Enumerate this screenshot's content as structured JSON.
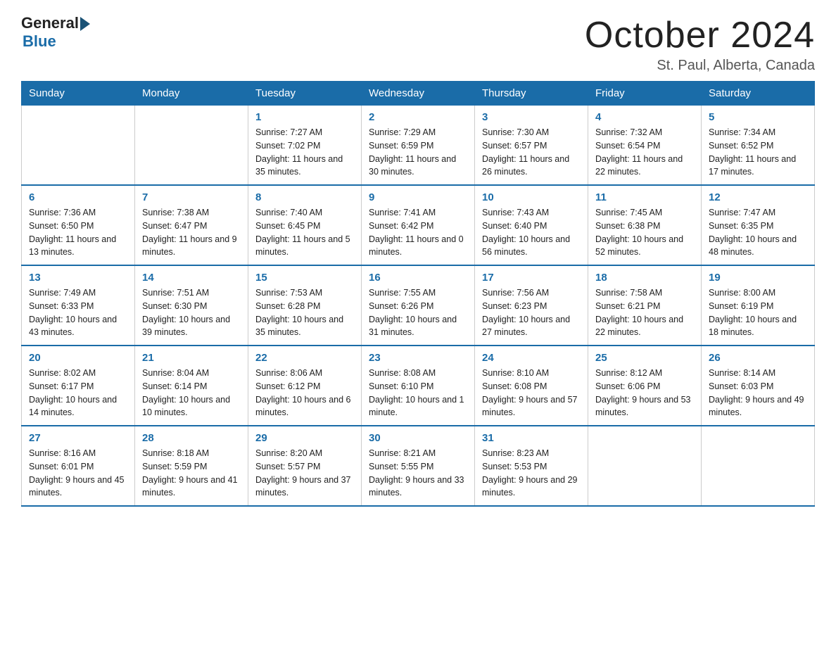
{
  "logo": {
    "general": "General",
    "blue": "Blue"
  },
  "title": "October 2024",
  "location": "St. Paul, Alberta, Canada",
  "days_of_week": [
    "Sunday",
    "Monday",
    "Tuesday",
    "Wednesday",
    "Thursday",
    "Friday",
    "Saturday"
  ],
  "weeks": [
    [
      {
        "day": "",
        "info": ""
      },
      {
        "day": "",
        "info": ""
      },
      {
        "day": "1",
        "info": "Sunrise: 7:27 AM\nSunset: 7:02 PM\nDaylight: 11 hours and 35 minutes."
      },
      {
        "day": "2",
        "info": "Sunrise: 7:29 AM\nSunset: 6:59 PM\nDaylight: 11 hours and 30 minutes."
      },
      {
        "day": "3",
        "info": "Sunrise: 7:30 AM\nSunset: 6:57 PM\nDaylight: 11 hours and 26 minutes."
      },
      {
        "day": "4",
        "info": "Sunrise: 7:32 AM\nSunset: 6:54 PM\nDaylight: 11 hours and 22 minutes."
      },
      {
        "day": "5",
        "info": "Sunrise: 7:34 AM\nSunset: 6:52 PM\nDaylight: 11 hours and 17 minutes."
      }
    ],
    [
      {
        "day": "6",
        "info": "Sunrise: 7:36 AM\nSunset: 6:50 PM\nDaylight: 11 hours and 13 minutes."
      },
      {
        "day": "7",
        "info": "Sunrise: 7:38 AM\nSunset: 6:47 PM\nDaylight: 11 hours and 9 minutes."
      },
      {
        "day": "8",
        "info": "Sunrise: 7:40 AM\nSunset: 6:45 PM\nDaylight: 11 hours and 5 minutes."
      },
      {
        "day": "9",
        "info": "Sunrise: 7:41 AM\nSunset: 6:42 PM\nDaylight: 11 hours and 0 minutes."
      },
      {
        "day": "10",
        "info": "Sunrise: 7:43 AM\nSunset: 6:40 PM\nDaylight: 10 hours and 56 minutes."
      },
      {
        "day": "11",
        "info": "Sunrise: 7:45 AM\nSunset: 6:38 PM\nDaylight: 10 hours and 52 minutes."
      },
      {
        "day": "12",
        "info": "Sunrise: 7:47 AM\nSunset: 6:35 PM\nDaylight: 10 hours and 48 minutes."
      }
    ],
    [
      {
        "day": "13",
        "info": "Sunrise: 7:49 AM\nSunset: 6:33 PM\nDaylight: 10 hours and 43 minutes."
      },
      {
        "day": "14",
        "info": "Sunrise: 7:51 AM\nSunset: 6:30 PM\nDaylight: 10 hours and 39 minutes."
      },
      {
        "day": "15",
        "info": "Sunrise: 7:53 AM\nSunset: 6:28 PM\nDaylight: 10 hours and 35 minutes."
      },
      {
        "day": "16",
        "info": "Sunrise: 7:55 AM\nSunset: 6:26 PM\nDaylight: 10 hours and 31 minutes."
      },
      {
        "day": "17",
        "info": "Sunrise: 7:56 AM\nSunset: 6:23 PM\nDaylight: 10 hours and 27 minutes."
      },
      {
        "day": "18",
        "info": "Sunrise: 7:58 AM\nSunset: 6:21 PM\nDaylight: 10 hours and 22 minutes."
      },
      {
        "day": "19",
        "info": "Sunrise: 8:00 AM\nSunset: 6:19 PM\nDaylight: 10 hours and 18 minutes."
      }
    ],
    [
      {
        "day": "20",
        "info": "Sunrise: 8:02 AM\nSunset: 6:17 PM\nDaylight: 10 hours and 14 minutes."
      },
      {
        "day": "21",
        "info": "Sunrise: 8:04 AM\nSunset: 6:14 PM\nDaylight: 10 hours and 10 minutes."
      },
      {
        "day": "22",
        "info": "Sunrise: 8:06 AM\nSunset: 6:12 PM\nDaylight: 10 hours and 6 minutes."
      },
      {
        "day": "23",
        "info": "Sunrise: 8:08 AM\nSunset: 6:10 PM\nDaylight: 10 hours and 1 minute."
      },
      {
        "day": "24",
        "info": "Sunrise: 8:10 AM\nSunset: 6:08 PM\nDaylight: 9 hours and 57 minutes."
      },
      {
        "day": "25",
        "info": "Sunrise: 8:12 AM\nSunset: 6:06 PM\nDaylight: 9 hours and 53 minutes."
      },
      {
        "day": "26",
        "info": "Sunrise: 8:14 AM\nSunset: 6:03 PM\nDaylight: 9 hours and 49 minutes."
      }
    ],
    [
      {
        "day": "27",
        "info": "Sunrise: 8:16 AM\nSunset: 6:01 PM\nDaylight: 9 hours and 45 minutes."
      },
      {
        "day": "28",
        "info": "Sunrise: 8:18 AM\nSunset: 5:59 PM\nDaylight: 9 hours and 41 minutes."
      },
      {
        "day": "29",
        "info": "Sunrise: 8:20 AM\nSunset: 5:57 PM\nDaylight: 9 hours and 37 minutes."
      },
      {
        "day": "30",
        "info": "Sunrise: 8:21 AM\nSunset: 5:55 PM\nDaylight: 9 hours and 33 minutes."
      },
      {
        "day": "31",
        "info": "Sunrise: 8:23 AM\nSunset: 5:53 PM\nDaylight: 9 hours and 29 minutes."
      },
      {
        "day": "",
        "info": ""
      },
      {
        "day": "",
        "info": ""
      }
    ]
  ]
}
